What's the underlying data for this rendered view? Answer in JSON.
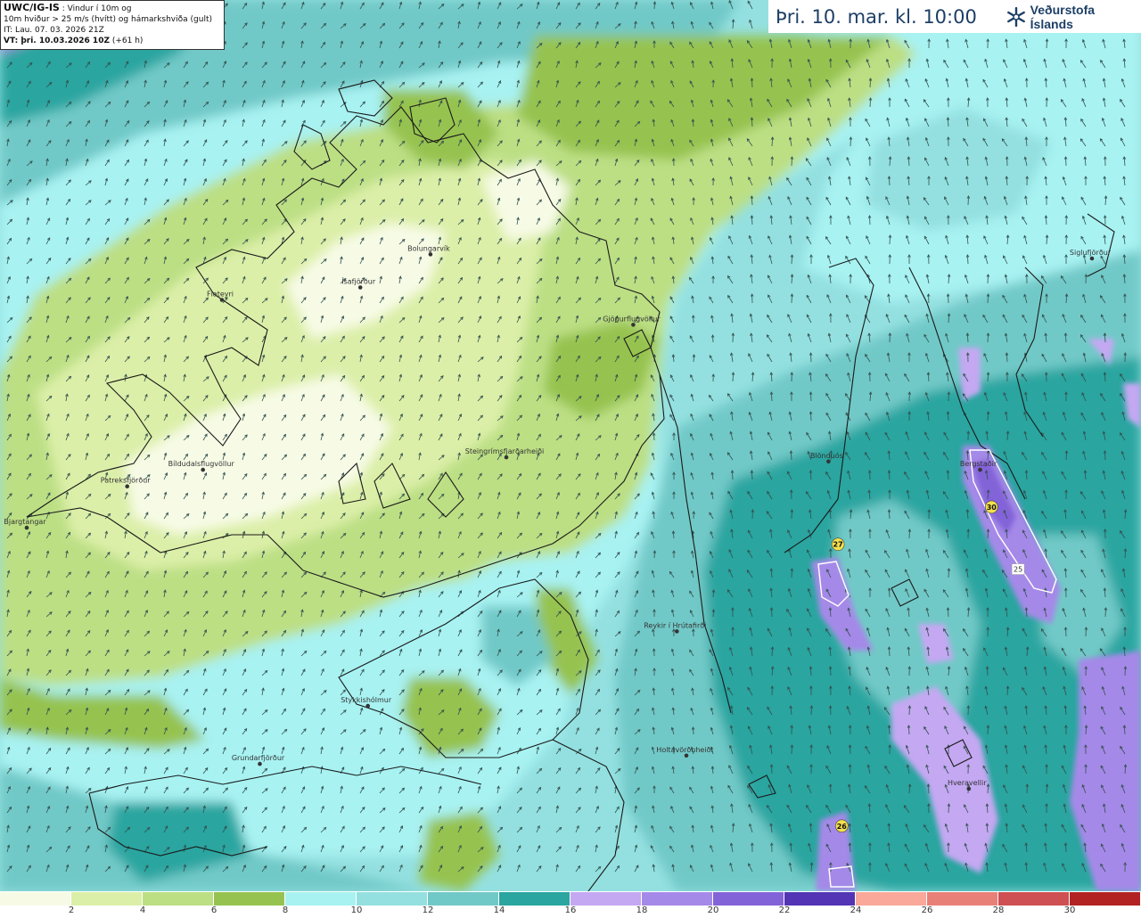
{
  "info": {
    "model": "UWC/IG-IS",
    "title_line1": ": Vindur í 10m og",
    "title_line2": "10m hviður > 25 m/s (hvítt) og hámarkshviða (gult)",
    "init_time": "IT: Lau. 07. 03. 2026 21Z",
    "valid_label": "VT: þri. 10.03.2026 10Z",
    "lead": "(+61 h)"
  },
  "header": {
    "valid_time": "Þri. 10. mar. kl. 10:00",
    "logo_text": "Veðurstofa Íslands",
    "logo_icon": "snowflake-logo-icon"
  },
  "places": [
    {
      "name": "Bolungarvík",
      "lon": -22.4,
      "lat": 66.16
    },
    {
      "name": "Ísafjörður",
      "lon": -22.77,
      "lat": 66.08
    },
    {
      "name": "Flateyri",
      "lon": -23.5,
      "lat": 66.05
    },
    {
      "name": "Patreksfjörður",
      "lon": -24.0,
      "lat": 65.6
    },
    {
      "name": "Bíldudalsflugvöllur",
      "lon": -23.6,
      "lat": 65.64
    },
    {
      "name": "Bjargtangar",
      "lon": -24.53,
      "lat": 65.5
    },
    {
      "name": "Steingrímsfjarðarheiði",
      "lon": -22.0,
      "lat": 65.67
    },
    {
      "name": "Gjögurflugvöllur",
      "lon": -21.33,
      "lat": 65.99
    },
    {
      "name": "Blönduós",
      "lon": -20.3,
      "lat": 65.66
    },
    {
      "name": "Bergstaðir",
      "lon": -19.5,
      "lat": 65.64
    },
    {
      "name": "Siglufjörður",
      "lon": -18.91,
      "lat": 66.15
    },
    {
      "name": "Reykir í Hrútafirði",
      "lon": -21.1,
      "lat": 65.25
    },
    {
      "name": "Stykkishólmur",
      "lon": -22.73,
      "lat": 65.07
    },
    {
      "name": "Holtavörðuheiði",
      "lon": -21.05,
      "lat": 64.95
    },
    {
      "name": "Grundarfjörður",
      "lon": -23.3,
      "lat": 64.93
    },
    {
      "name": "Hveravellir",
      "lon": -19.56,
      "lat": 64.87
    }
  ],
  "gust_markers": [
    {
      "value": "30",
      "lon": -19.44,
      "lat": 65.55
    },
    {
      "value": "27",
      "lon": -20.25,
      "lat": 65.46
    },
    {
      "value": "26",
      "lon": -20.23,
      "lat": 64.78
    }
  ],
  "contour_labels": [
    {
      "value": "25",
      "lon": -19.3,
      "lat": 65.4
    }
  ],
  "scale": {
    "colors": [
      "#f7fbe6",
      "#dcefa8",
      "#bcdf84",
      "#96c350",
      "#a8f2f2",
      "#94e0e0",
      "#71c9c7",
      "#2aa5a0",
      "#c4a8f2",
      "#a589e8",
      "#8363d8",
      "#5234b5",
      "#f9a89a",
      "#e88078",
      "#cf5052",
      "#b22222"
    ],
    "ticks": [
      "2",
      "4",
      "6",
      "8",
      "10",
      "12",
      "14",
      "16",
      "18",
      "20",
      "22",
      "24",
      "26",
      "28",
      "30"
    ]
  },
  "colors": {
    "coastline": "#1a1a1a",
    "header_text": "#1d3f66"
  }
}
